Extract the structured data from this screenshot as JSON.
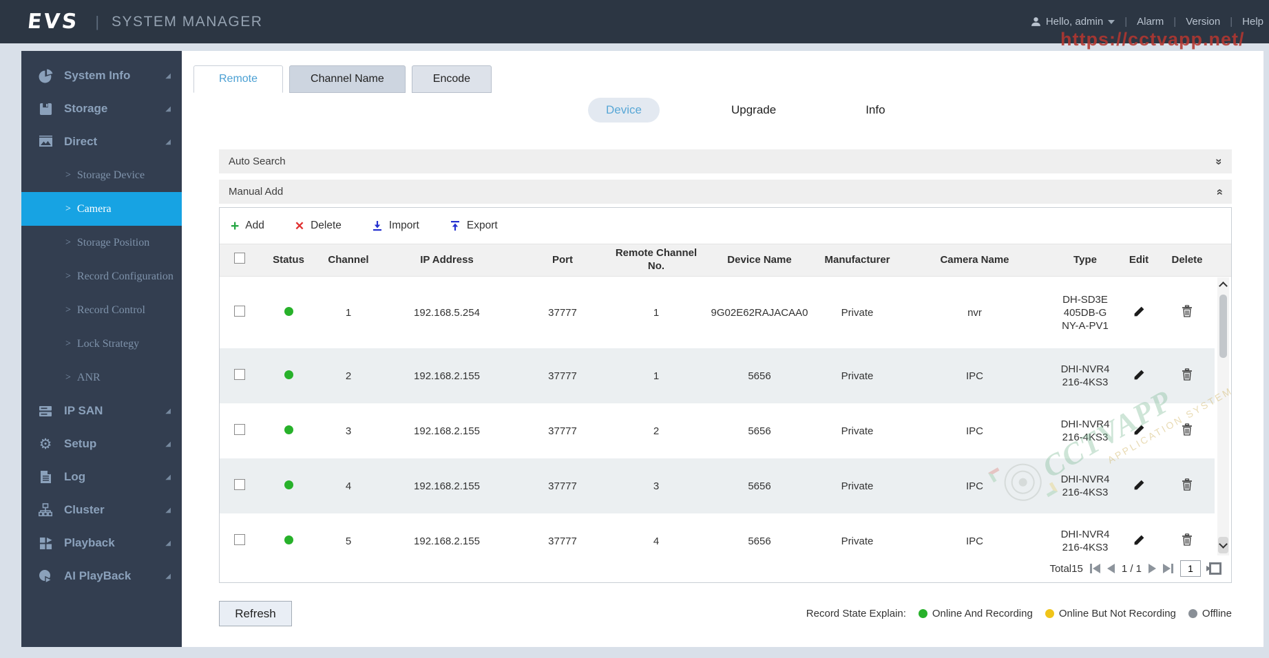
{
  "header": {
    "logo": "EVS",
    "app_title": "SYSTEM MANAGER",
    "greeting": "Hello, admin",
    "menu": [
      "Alarm",
      "Version",
      "Help"
    ]
  },
  "watermarks": {
    "top_url": "https://cctvapp.net/",
    "center_brand": "CCTVAPP",
    "center_sub": "APPLICATION SYSTEM"
  },
  "colors": {
    "sidebar_active": "#17a3e3",
    "tab_active_text": "#4ba0d3",
    "status_green": "#27b12a",
    "status_yellow": "#f0c419",
    "status_gray": "#898f96",
    "add_icon": "#28a745",
    "delete_icon": "#e03131",
    "import_export_icon": "#2531cf",
    "watermark_red": "#b4372f"
  },
  "sidebar": {
    "items": [
      {
        "label": "System Info",
        "icon": "pie-chart-icon"
      },
      {
        "label": "Storage",
        "icon": "floppy-disk-icon"
      },
      {
        "label": "Direct",
        "icon": "image-icon",
        "expanded": true,
        "children": [
          {
            "label": "Storage Device",
            "active": false
          },
          {
            "label": "Camera",
            "active": true
          },
          {
            "label": "Storage Position",
            "active": false
          },
          {
            "label": "Record Configuration",
            "active": false
          },
          {
            "label": "Record Control",
            "active": false
          },
          {
            "label": "Lock Strategy",
            "active": false
          },
          {
            "label": "ANR",
            "active": false
          }
        ]
      },
      {
        "label": "IP SAN",
        "icon": "server-icon"
      },
      {
        "label": "Setup",
        "icon": "gear-icon"
      },
      {
        "label": "Log",
        "icon": "log-icon"
      },
      {
        "label": "Cluster",
        "icon": "cluster-icon"
      },
      {
        "label": "Playback",
        "icon": "playback-icon"
      },
      {
        "label": "AI PlayBack",
        "icon": "ai-playback-icon"
      }
    ]
  },
  "tabs": {
    "items": [
      "Remote",
      "Channel Name",
      "Encode"
    ],
    "active": "Remote"
  },
  "subtabs": {
    "items": [
      "Device",
      "Upgrade",
      "Info"
    ],
    "active": "Device"
  },
  "sections": {
    "auto_search": "Auto Search",
    "manual_add": "Manual Add"
  },
  "toolbar": {
    "add": "Add",
    "delete": "Delete",
    "import": "Import",
    "export": "Export"
  },
  "table": {
    "headers": {
      "status": "Status",
      "channel": "Channel",
      "ip": "IP Address",
      "port": "Port",
      "remote_channel": "Remote Channel No.",
      "device_name": "Device Name",
      "manufacturer": "Manufacturer",
      "camera_name": "Camera Name",
      "type": "Type",
      "edit": "Edit",
      "delete": "Delete"
    },
    "rows": [
      {
        "channel": "1",
        "ip": "192.168.5.254",
        "port": "37777",
        "remote_channel": "1",
        "device_name": "9G02E62RAJACAA0",
        "manufacturer": "Private",
        "camera_name": "nvr",
        "type": "DH-SD3E405DB-GNY-A-PV1",
        "status": "Online And Recording",
        "status_color": "#27b12a"
      },
      {
        "channel": "2",
        "ip": "192.168.2.155",
        "port": "37777",
        "remote_channel": "1",
        "device_name": "5656",
        "manufacturer": "Private",
        "camera_name": "IPC",
        "type": "DHI-NVR4216-4KS3",
        "status": "Online And Recording",
        "status_color": "#27b12a"
      },
      {
        "channel": "3",
        "ip": "192.168.2.155",
        "port": "37777",
        "remote_channel": "2",
        "device_name": "5656",
        "manufacturer": "Private",
        "camera_name": "IPC",
        "type": "DHI-NVR4216-4KS3",
        "status": "Online And Recording",
        "status_color": "#27b12a"
      },
      {
        "channel": "4",
        "ip": "192.168.2.155",
        "port": "37777",
        "remote_channel": "3",
        "device_name": "5656",
        "manufacturer": "Private",
        "camera_name": "IPC",
        "type": "DHI-NVR4216-4KS3",
        "status": "Online And Recording",
        "status_color": "#27b12a"
      },
      {
        "channel": "5",
        "ip": "192.168.2.155",
        "port": "37777",
        "remote_channel": "4",
        "device_name": "5656",
        "manufacturer": "Private",
        "camera_name": "IPC",
        "type": "DHI-NVR4216-4KS3",
        "status": "Online And Recording",
        "status_color": "#27b12a"
      }
    ]
  },
  "pagination": {
    "total": "Total15",
    "page": "1 / 1",
    "page_input": "1"
  },
  "footer": {
    "refresh": "Refresh",
    "legend_title": "Record State Explain:",
    "legend": [
      {
        "label": "Online And Recording",
        "color": "#27b12a"
      },
      {
        "label": "Online But Not Recording",
        "color": "#f0c419"
      },
      {
        "label": "Offline",
        "color": "#898f96"
      }
    ]
  }
}
